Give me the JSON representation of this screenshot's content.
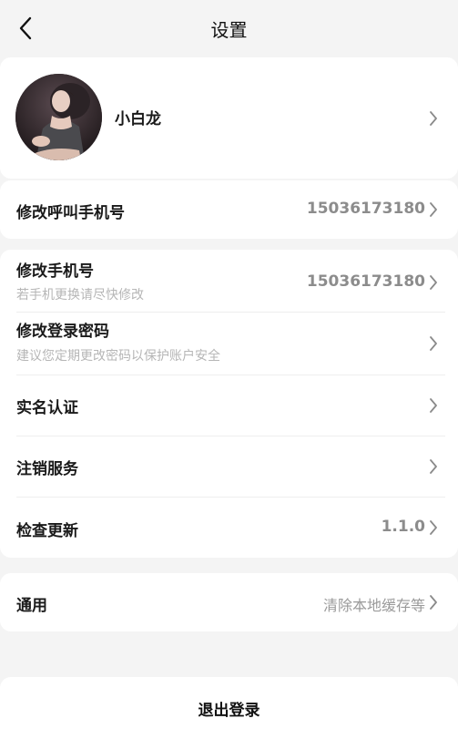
{
  "header": {
    "title": "设置"
  },
  "profile": {
    "name": "小白龙"
  },
  "rows": {
    "call_phone": {
      "label": "修改呼叫手机号",
      "value": "15036173180"
    },
    "phone": {
      "label": "修改手机号",
      "sub": "若手机更换请尽快修改",
      "value": "15036173180"
    },
    "password": {
      "label": "修改登录密码",
      "sub": "建议您定期更改密码以保护账户安全"
    },
    "realname": {
      "label": "实名认证"
    },
    "cancel": {
      "label": "注销服务"
    },
    "update": {
      "label": "检查更新",
      "value": "1.1.0"
    },
    "general": {
      "label": "通用",
      "value": "清除本地缓存等"
    }
  },
  "logout": {
    "label": "退出登录"
  },
  "colors": {
    "background": "#f4f4f4",
    "card": "#ffffff",
    "muted": "#8c8c8c",
    "hint": "#b6b6b6"
  },
  "icons": {
    "back": "chevron-left-icon",
    "row_arrow": "chevron-right-icon"
  }
}
